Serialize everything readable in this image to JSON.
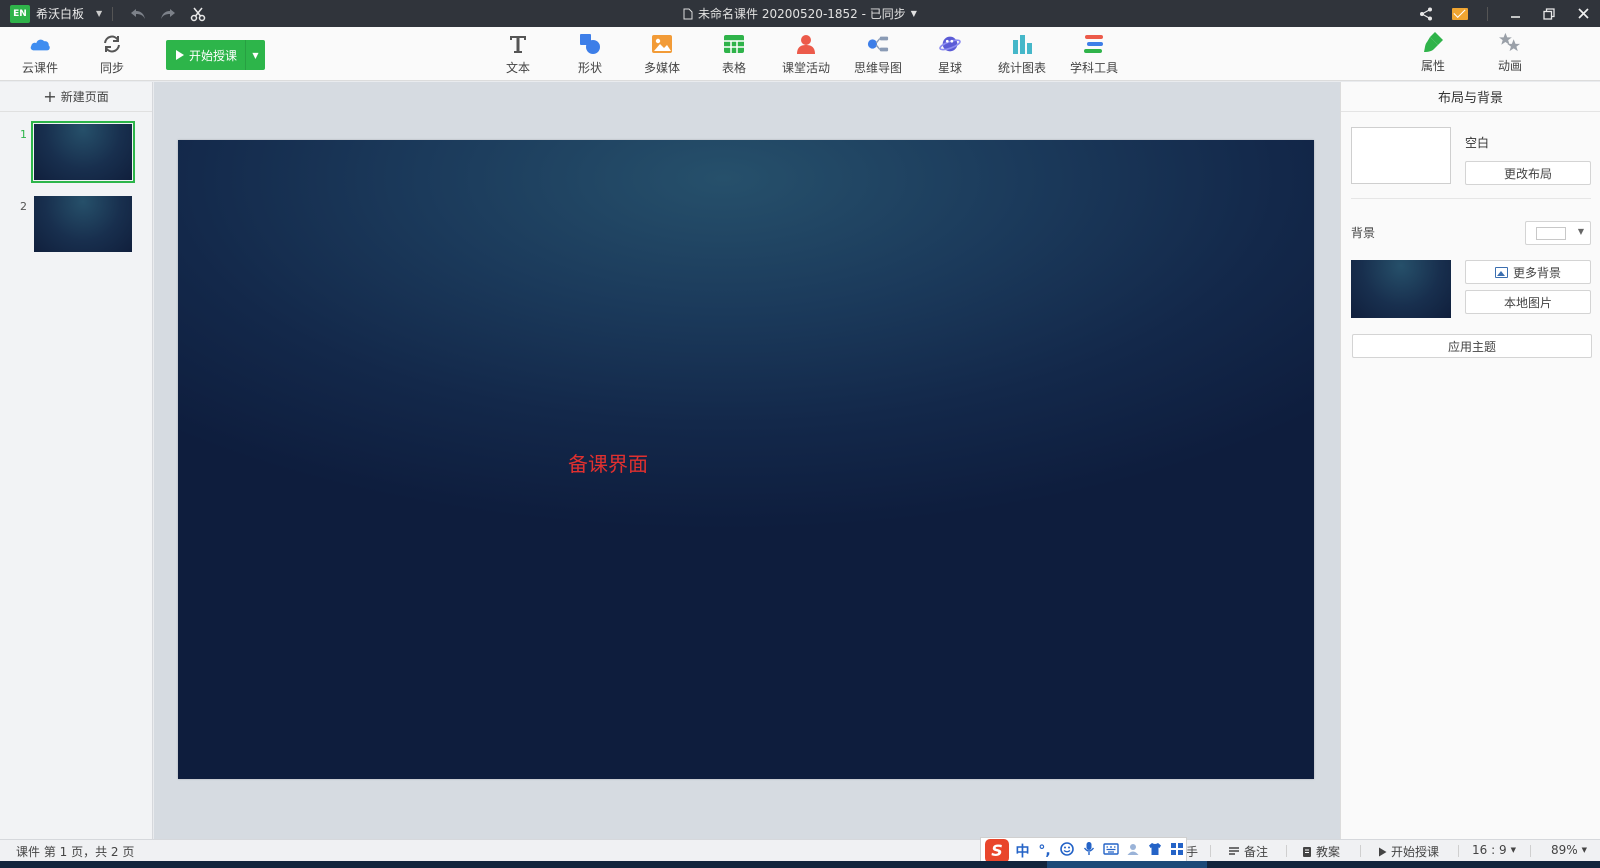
{
  "titlebar": {
    "app_logo_text": "EN",
    "app_name": "希沃白板",
    "doc_title": "未命名课件 20200520-1852 - 已同步"
  },
  "toolbar": {
    "cloud_label": "云课件",
    "sync_label": "同步",
    "start_teaching_label": "开始授课",
    "tools": [
      {
        "label": "文本",
        "icon": "text-icon"
      },
      {
        "label": "形状",
        "icon": "shape-icon"
      },
      {
        "label": "多媒体",
        "icon": "media-icon"
      },
      {
        "label": "表格",
        "icon": "table-icon"
      },
      {
        "label": "课堂活动",
        "icon": "activity-icon"
      },
      {
        "label": "思维导图",
        "icon": "mindmap-icon"
      },
      {
        "label": "星球",
        "icon": "planet-icon"
      },
      {
        "label": "统计图表",
        "icon": "chart-icon"
      },
      {
        "label": "学科工具",
        "icon": "subject-tools-icon"
      }
    ],
    "properties_label": "属性",
    "animation_label": "动画"
  },
  "left_panel": {
    "new_page_label": "新建页面",
    "pages": [
      {
        "number": "1",
        "active": true
      },
      {
        "number": "2",
        "active": false
      }
    ]
  },
  "slide": {
    "text": "备课界面",
    "text_color": "#e0302f"
  },
  "right_panel": {
    "title": "布局与背景",
    "layout_name": "空白",
    "change_layout_label": "更改布局",
    "background_label": "背景",
    "more_backgrounds_label": "更多背景",
    "local_image_label": "本地图片",
    "apply_theme_label": "应用主题"
  },
  "statusbar": {
    "page_info": "课件 第 1 页，共 2 页",
    "hidden_partial": "手",
    "notes_label": "备注",
    "lesson_plan_label": "教案",
    "start_teaching_label": "开始授课",
    "aspect_ratio": "16 : 9",
    "zoom": "89%"
  },
  "ime": {
    "logo": "S",
    "mode": "中",
    "punct": "°,"
  },
  "colors": {
    "accent_green": "#2db54a",
    "titlebar_bg": "#30343b",
    "slide_bg": "#13284a"
  }
}
